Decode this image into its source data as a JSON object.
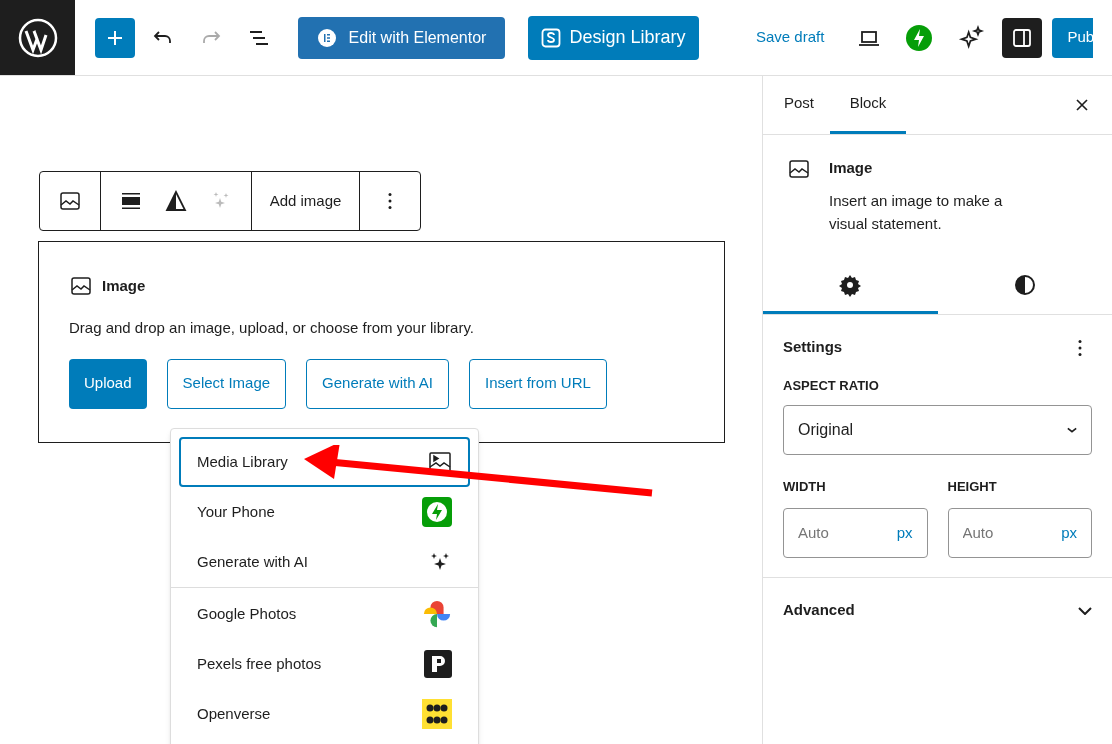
{
  "topbar": {
    "edit_elementor": "Edit with Elementor",
    "design_library": "Design Library",
    "save_draft": "Save draft",
    "publish": "Pub",
    "redo_disabled": true,
    "sidebar_toggle_on": true
  },
  "block_toolbar": {
    "add_image": "Add image"
  },
  "placeholder_block": {
    "title": "Image",
    "instructions": "Drag and drop an image, upload, or choose from your library.",
    "buttons": [
      {
        "label": "Upload",
        "kind": "primary"
      },
      {
        "label": "Select Image",
        "kind": "outline"
      },
      {
        "label": "Generate with AI",
        "kind": "outline"
      },
      {
        "label": "Insert from URL",
        "kind": "outline"
      }
    ]
  },
  "media_menu": {
    "groups": [
      [
        {
          "label": "Media Library",
          "kind": "media",
          "selected": true
        },
        {
          "label": "Your Phone",
          "kind": "phone",
          "selected": false
        },
        {
          "label": "Generate with AI",
          "kind": "ai",
          "selected": false
        }
      ],
      [
        {
          "label": "Google Photos",
          "kind": "google",
          "selected": false
        },
        {
          "label": "Pexels free photos",
          "kind": "pexels",
          "selected": false
        },
        {
          "label": "Openverse",
          "kind": "openverse",
          "selected": false
        }
      ]
    ]
  },
  "sidebar": {
    "tabs": [
      {
        "label": "Post",
        "selected": false
      },
      {
        "label": "Block",
        "selected": true
      }
    ],
    "block_card": {
      "title": "Image",
      "description": "Insert an image to make a visual statement."
    },
    "inspector_tabs": [
      {
        "kind": "settings",
        "selected": true
      },
      {
        "kind": "styles",
        "selected": false
      }
    ],
    "settings": {
      "title": "Settings",
      "aspect_ratio_label": "ASPECT RATIO",
      "aspect_ratio_value": "Original",
      "width": {
        "label": "WIDTH",
        "placeholder": "Auto",
        "unit": "px"
      },
      "height": {
        "label": "HEIGHT",
        "placeholder": "Auto",
        "unit": "px"
      }
    },
    "advanced": {
      "title": "Advanced",
      "expanded": false
    }
  }
}
